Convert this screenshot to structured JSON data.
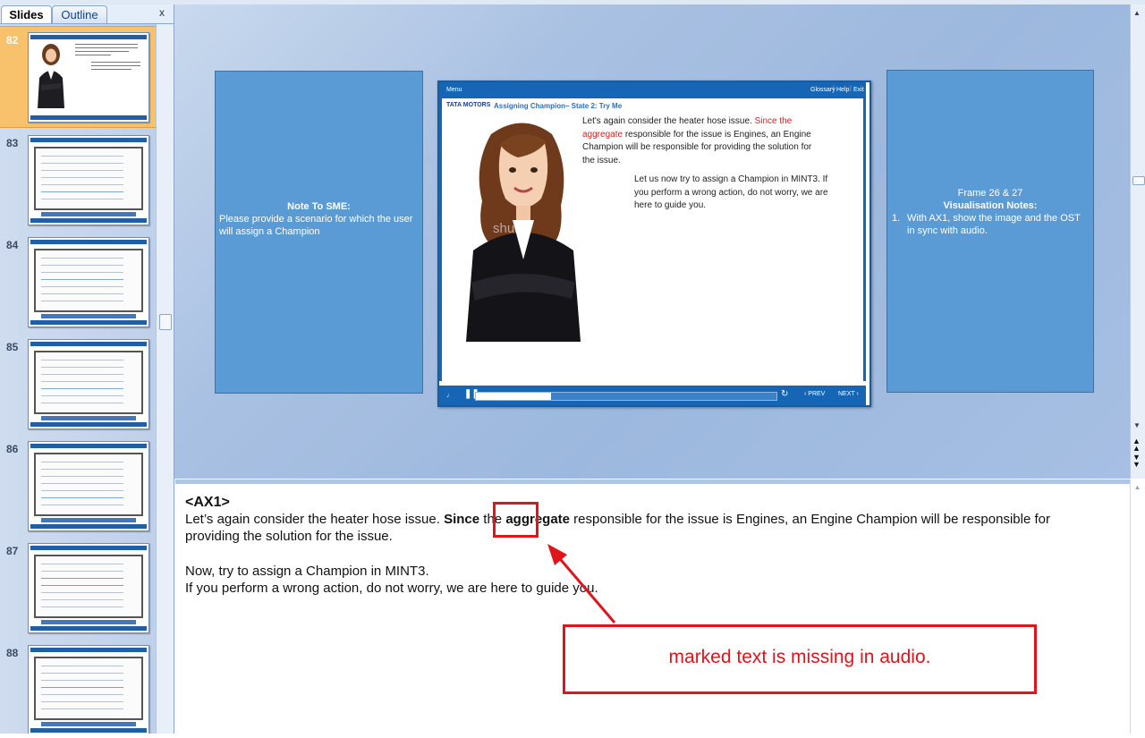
{
  "panel": {
    "tabs": [
      "Slides",
      "Outline"
    ],
    "close_glyph": "x",
    "slides": [
      {
        "number": "82",
        "selected": true
      },
      {
        "number": "83",
        "selected": false
      },
      {
        "number": "84",
        "selected": false
      },
      {
        "number": "85",
        "selected": false
      },
      {
        "number": "86",
        "selected": false
      },
      {
        "number": "87",
        "selected": false
      },
      {
        "number": "88",
        "selected": false
      }
    ]
  },
  "slide": {
    "menu_label": "Menu",
    "header_links": [
      "Glossary",
      "Help",
      "Exit"
    ],
    "brand": "TATA MOTORS",
    "title": "Assigning Champion– State 2: Try Me",
    "para1_normal": "Let's again consider the heater hose issue. ",
    "para1_red": "Since the aggregate",
    "para1_rest": " responsible for the issue is Engines, an Engine Champion will be responsible for providing the solution for the issue.",
    "para2": "Let us now try to assign a Champion in MINT3. If you perform a wrong action, do not worry, we are here to guide you.",
    "watermark": "shutte",
    "prev_label": "PREV",
    "next_label": "NEXT",
    "progress": 0.25
  },
  "note_left": {
    "heading": "Note To SME:",
    "body": "Please provide a scenario for which the user will assign a Champion"
  },
  "note_right": {
    "frame": "Frame 26 & 27",
    "heading": "Visualisation Notes:",
    "item_number": "1.",
    "item_text": "With AX1, show the image and the OST in sync with audio."
  },
  "notes": {
    "tag": "<AX1>",
    "line1_a": "Let’s again consider the heater hose issue. ",
    "line1_b": "Since",
    "line1_c": " the ",
    "line1_d": "aggregate",
    "line1_e": " responsible for the issue is Engines, an Engine Champion will be responsible for",
    "line2": "providing the solution for the issue.",
    "line3": "Now, try to assign a Champion in MINT3.",
    "line4": "If you perform a wrong action, do not worry, we are here to guide you."
  },
  "annotation": {
    "text": "marked text is missing in audio.",
    "color": "#e0141a"
  }
}
